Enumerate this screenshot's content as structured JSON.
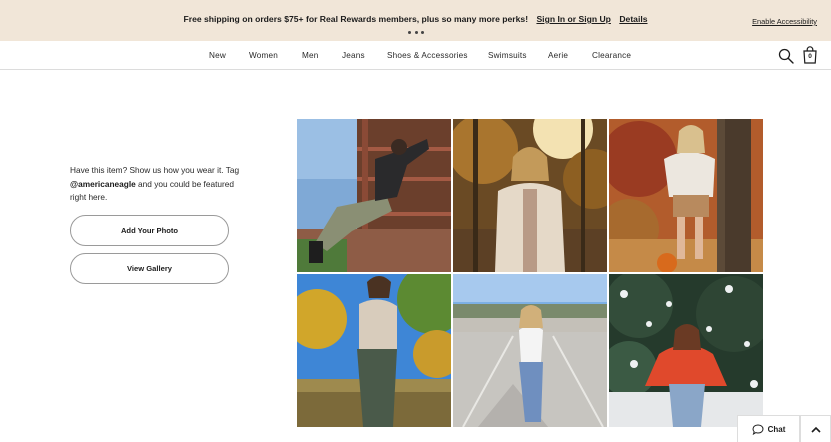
{
  "promo": {
    "message": "Free shipping on orders $75+ for Real Rewards members, plus so many more perks!",
    "signin_link": "Sign In or Sign Up",
    "details_link": "Details",
    "accessibility_link": "Enable Accessibility"
  },
  "nav": {
    "items": [
      "New",
      "Women",
      "Men",
      "Jeans",
      "Shoes & Accessories",
      "Swimsuits",
      "Aerie",
      "Clearance"
    ],
    "bag_count": "0"
  },
  "ugc": {
    "copy_before": "Have this item? Show us how you wear it. Tag ",
    "handle": "@americaneagle",
    "copy_after": " and you could be featured right here.",
    "add_photo_button": "Add Your Photo",
    "view_gallery_button": "View Gallery"
  },
  "chat": {
    "label": "Chat"
  },
  "colors": {
    "promo_bg": "#f1e6d8",
    "divider": "#dcdcdc",
    "button_border": "#9a9a9a"
  },
  "icons": [
    "search-icon",
    "shopping-bag-icon",
    "chat-bubble-icon",
    "chevron-up-icon"
  ]
}
